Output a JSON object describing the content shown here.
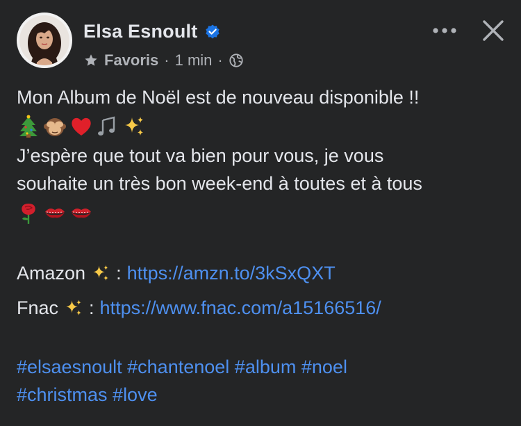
{
  "header": {
    "author_name": "Elsa Esnoult",
    "audience_label": "Favoris",
    "separator": "·",
    "timestamp": "1 min",
    "icons": [
      "avatar",
      "verified-badge-icon",
      "star-icon",
      "globe-icon",
      "more-options-icon",
      "close-icon"
    ]
  },
  "post": {
    "line1": "Mon Album de Noël est de nouveau disponible !!",
    "emojis1": [
      "christmas-tree",
      "see-no-evil-monkey",
      "red-heart",
      "musical-notes",
      "sparkles"
    ],
    "line2": "J’espère que tout va bien pour vous, je vous",
    "line3": "souhaite un très bon week-end à toutes et à tous",
    "emojis2": [
      "rose",
      "kiss-mark",
      "kiss-mark"
    ],
    "amazon_label": "Amazon",
    "amazon_sep": ":",
    "amazon_url": "https://amzn.to/3kSxQXT",
    "fnac_label": "Fnac",
    "fnac_sep": ":",
    "fnac_url": "https://www.fnac.com/a15166516/",
    "hashtags": [
      {
        "text": "#elsaesnoult"
      },
      {
        "text": "#chantenoel"
      },
      {
        "text": "#album"
      },
      {
        "text": "#noel"
      },
      {
        "text": "#christmas"
      },
      {
        "text": "#love"
      }
    ]
  },
  "colors": {
    "background": "#242526",
    "text": "#e4e6eb",
    "secondary_text": "#b0b3b8",
    "link": "#4e90f0",
    "verified": "#1b74e4"
  }
}
